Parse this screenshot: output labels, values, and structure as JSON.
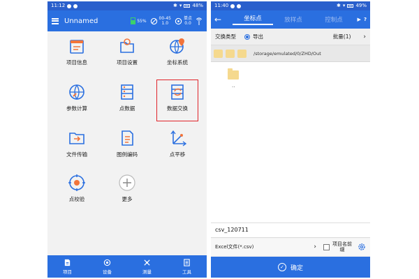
{
  "left": {
    "status": {
      "time": "11:12",
      "battery": "48%"
    },
    "appbar": {
      "title": "Unnamed",
      "battery_pct": "55%",
      "age": "00-45",
      "age_val": "1.0",
      "single_label": "单点",
      "single_val": "0.0"
    },
    "tiles": [
      {
        "label": "项目信息",
        "icon": "project-info-icon"
      },
      {
        "label": "项目设置",
        "icon": "project-settings-icon"
      },
      {
        "label": "坐标系统",
        "icon": "coordinate-system-icon"
      },
      {
        "label": "参数计算",
        "icon": "parameter-calc-icon"
      },
      {
        "label": "点数据",
        "icon": "point-data-icon"
      },
      {
        "label": "数据交换",
        "icon": "data-exchange-icon"
      },
      {
        "label": "文件传输",
        "icon": "file-transfer-icon"
      },
      {
        "label": "图例编码",
        "icon": "legend-code-icon"
      },
      {
        "label": "点平移",
        "icon": "point-shift-icon"
      },
      {
        "label": "点校验",
        "icon": "point-check-icon"
      },
      {
        "label": "更多",
        "icon": "more-icon"
      }
    ],
    "nav": [
      {
        "label": "项目",
        "icon": "project-icon"
      },
      {
        "label": "设备",
        "icon": "device-icon"
      },
      {
        "label": "测量",
        "icon": "measure-icon"
      },
      {
        "label": "工具",
        "icon": "tools-icon"
      }
    ],
    "colors": {
      "primary": "#2a6fe0",
      "icon_orange": "#f2743a",
      "highlight": "#e0242a"
    }
  },
  "right": {
    "status": {
      "time": "11:40",
      "battery": "49%"
    },
    "tabs": [
      "坐标点",
      "放样点",
      "控制点"
    ],
    "type_row": {
      "label": "交换类型",
      "option": "导出",
      "batch": "批量(1)"
    },
    "path": "/storage/emulated/0/ZHD/Out",
    "parent_dir": "..",
    "filename": "csv_120711",
    "format": "Excel文件(*.csv)",
    "prefix_label": "项目名前缀",
    "confirm": "确定"
  }
}
